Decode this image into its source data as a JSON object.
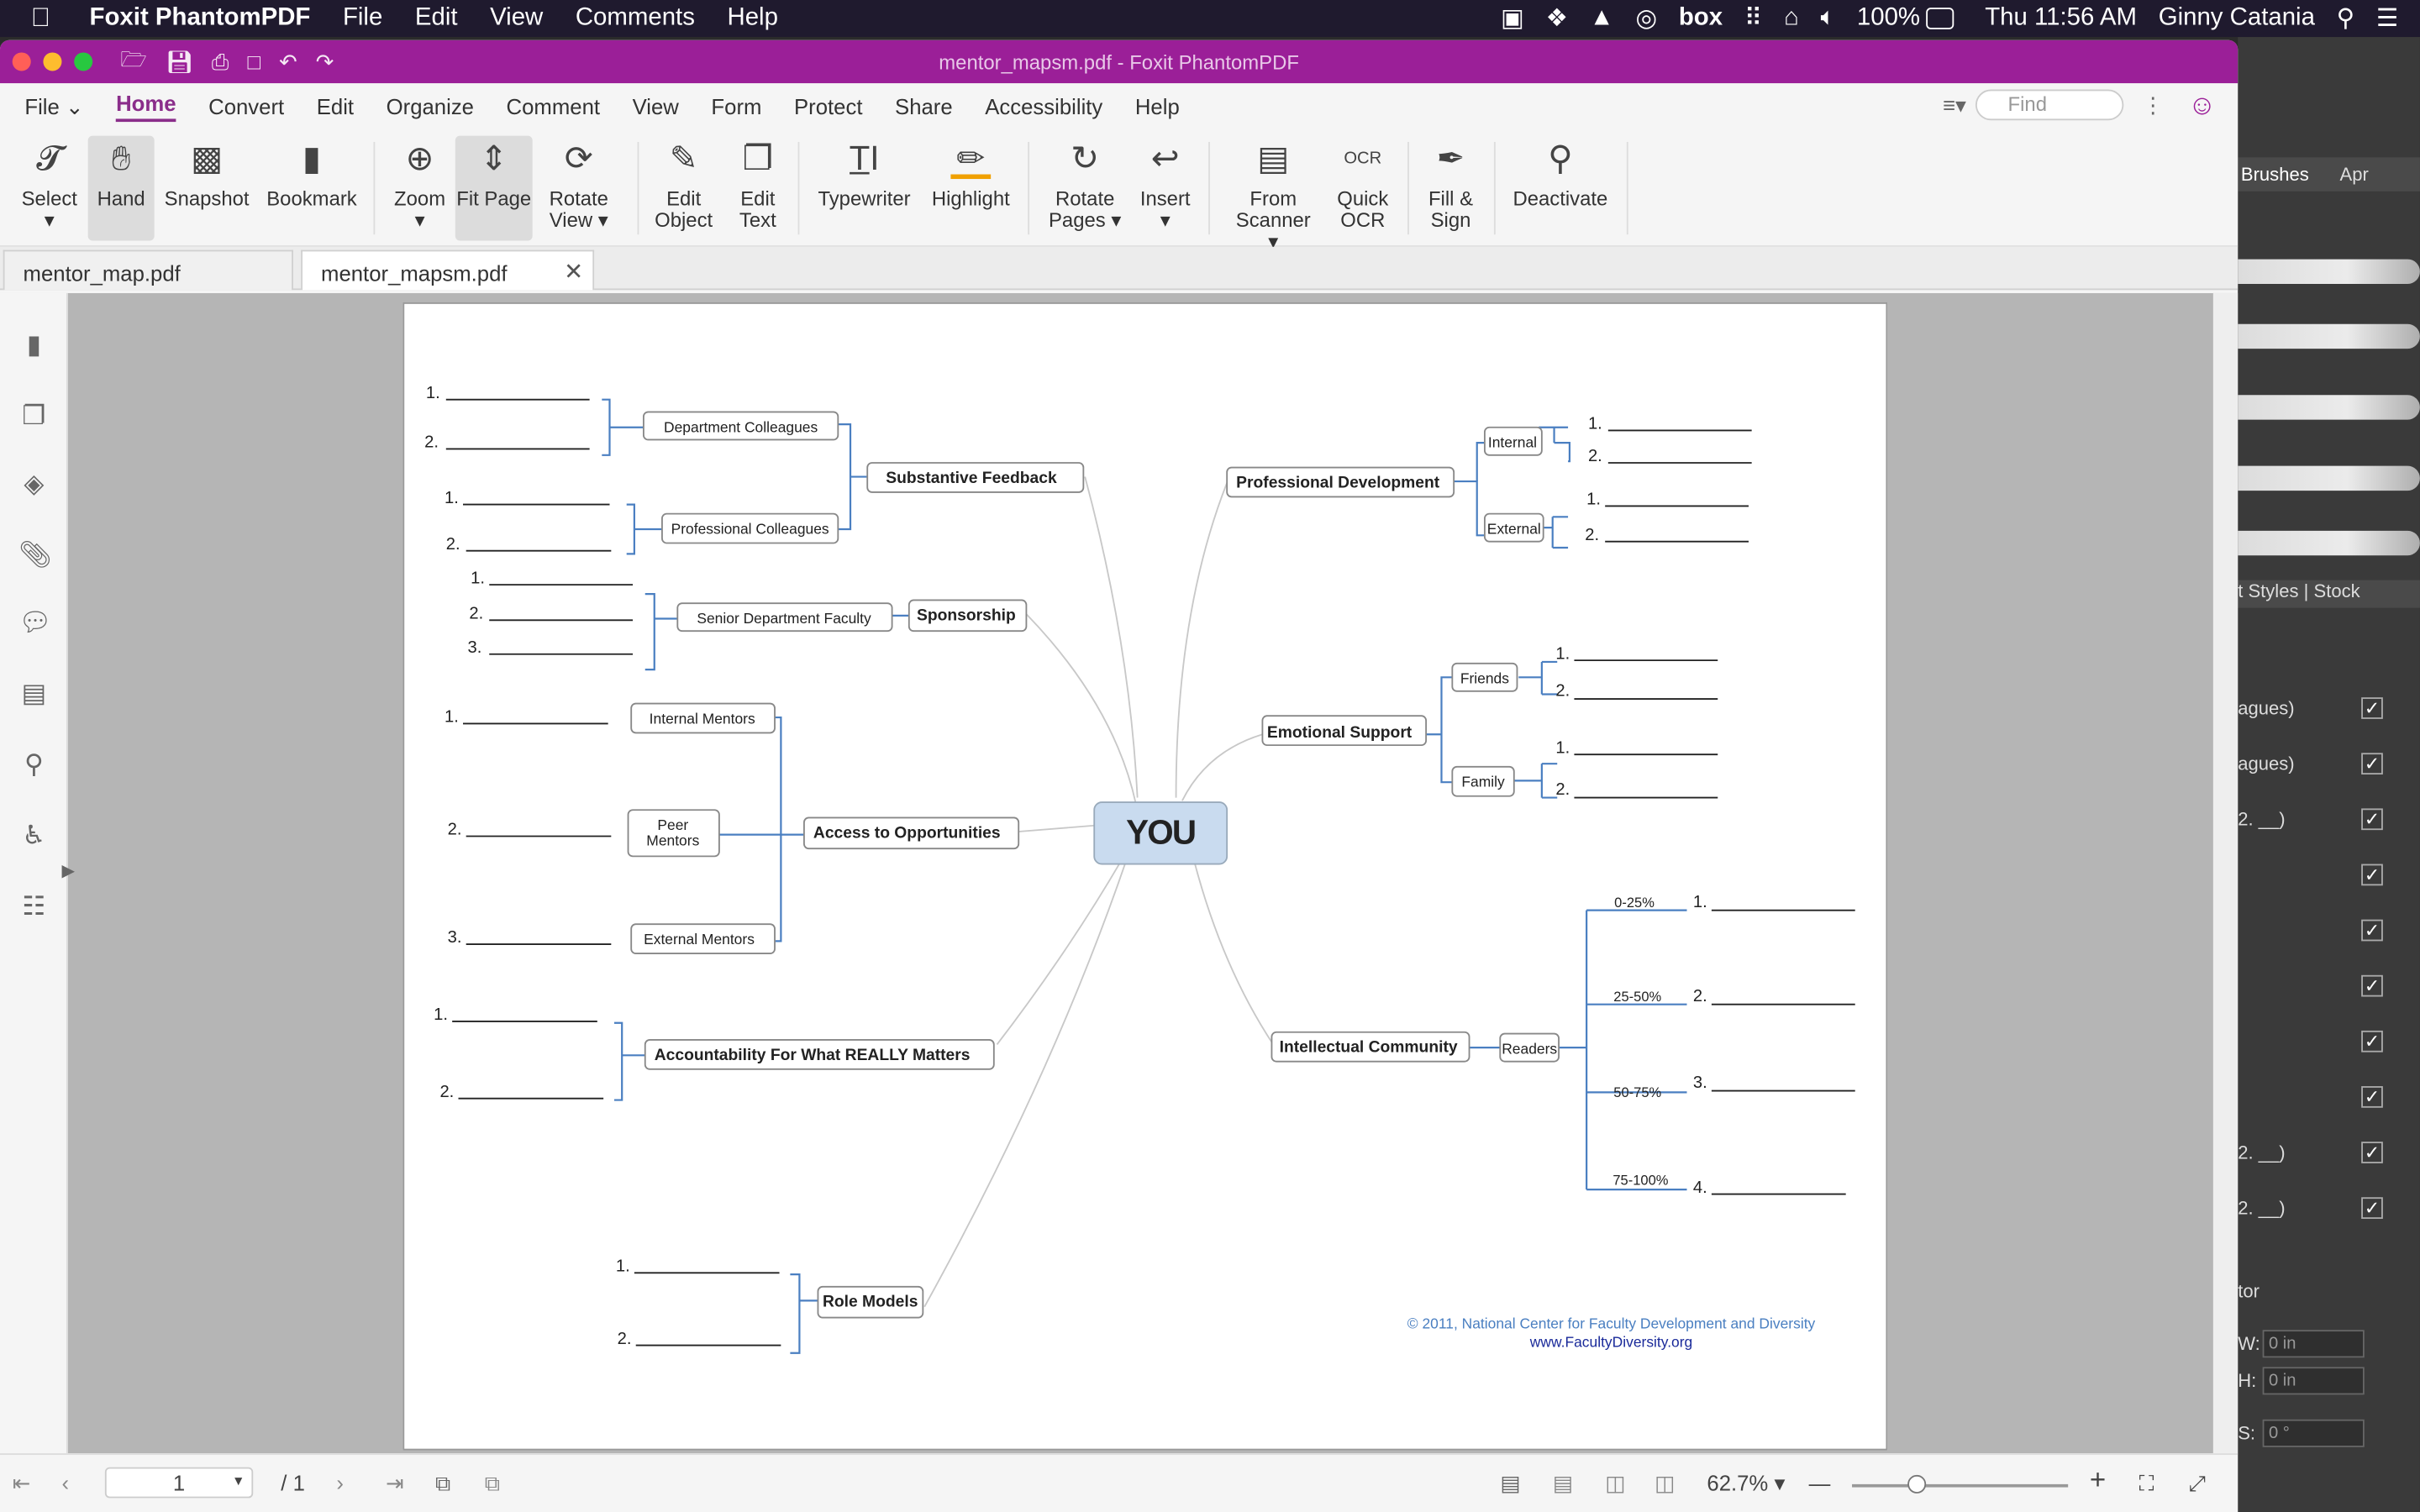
{
  "menubar": {
    "app_name": "Foxit PhantomPDF",
    "items": [
      "File",
      "Edit",
      "View",
      "Comments",
      "Help"
    ],
    "battery": "100%",
    "clock": "Thu 11:56 AM",
    "user": "Ginny Catania",
    "box_label": "box"
  },
  "window": {
    "title": "mentor_mapsm.pdf - Foxit PhantomPDF"
  },
  "tabs": {
    "file": "File",
    "items": [
      "Home",
      "Convert",
      "Edit",
      "Organize",
      "Comment",
      "View",
      "Form",
      "Protect",
      "Share",
      "Accessibility",
      "Help"
    ],
    "search_placeholder": "Find"
  },
  "ribbon": {
    "select": "Select",
    "hand": "Hand",
    "snapshot": "Snapshot",
    "bookmark": "Bookmark",
    "zoom": "Zoom",
    "fit_page": "Fit Page",
    "rotate_view_1": "Rotate",
    "rotate_view_2": "View",
    "edit_object_1": "Edit",
    "edit_object_2": "Object",
    "edit_text_1": "Edit",
    "edit_text_2": "Text",
    "typewriter": "Typewriter",
    "highlight": "Highlight",
    "rotate_pages_1": "Rotate",
    "rotate_pages_2": "Pages",
    "insert": "Insert",
    "from_scanner_1": "From",
    "from_scanner_2": "Scanner",
    "quick_ocr_1": "Quick",
    "quick_ocr_2": "OCR",
    "fill_sign_1": "Fill &",
    "fill_sign_2": "Sign",
    "deactivate": "Deactivate"
  },
  "doc_tabs": {
    "tab1": "mentor_map.pdf",
    "tab2": "mentor_mapsm.pdf"
  },
  "mindmap": {
    "center": "YOU",
    "n1": "1.",
    "n2": "2.",
    "n3": "3.",
    "n4": "4.",
    "department_colleagues": "Department Colleagues",
    "professional_colleagues": "Professional Colleagues",
    "substantive_feedback": "Substantive Feedback",
    "senior_department_faculty": "Senior Department Faculty",
    "sponsorship": "Sponsorship",
    "internal_mentors": "Internal Mentors",
    "peer_mentors_1": "Peer",
    "peer_mentors_2": "Mentors",
    "external_mentors": "External Mentors",
    "access_to_opportunities": "Access to Opportunities",
    "accountability": "Accountability For What REALLY Matters",
    "role_models": "Role Models",
    "professional_development": "Professional Development",
    "internal": "Internal",
    "external": "External",
    "emotional_support": "Emotional Support",
    "friends": "Friends",
    "family": "Family",
    "intellectual_community": "Intellectual Community",
    "readers": "Readers",
    "q1": "0-25%",
    "q2": "25-50%",
    "q3": "50-75%",
    "q4": "75-100%",
    "copyright": "© 2011, National Center for Faculty Development and Diversity",
    "website": "www.FacultyDiversity.org"
  },
  "statusbar": {
    "page_current": "1",
    "page_total": "/ 1",
    "zoom": "62.7%"
  },
  "bg_panel": {
    "brushes": "Brushes",
    "apr": "Apr",
    "styles": "t Styles",
    "stock": "Stock",
    "rows": [
      "agues)",
      "agues)",
      "2. __)",
      "",
      "",
      "",
      "",
      "",
      "2. __)",
      "2. __)"
    ],
    "tor": "tor",
    "w_label": "W:",
    "w_val": "0 in",
    "h_label": "H:",
    "h_val": "0 in",
    "s_label": "S:",
    "s_val": "0 °"
  },
  "colors": {
    "accent": "#9b1f98",
    "bracket": "#4a7fc1",
    "center_fill": "#c9dbef"
  }
}
